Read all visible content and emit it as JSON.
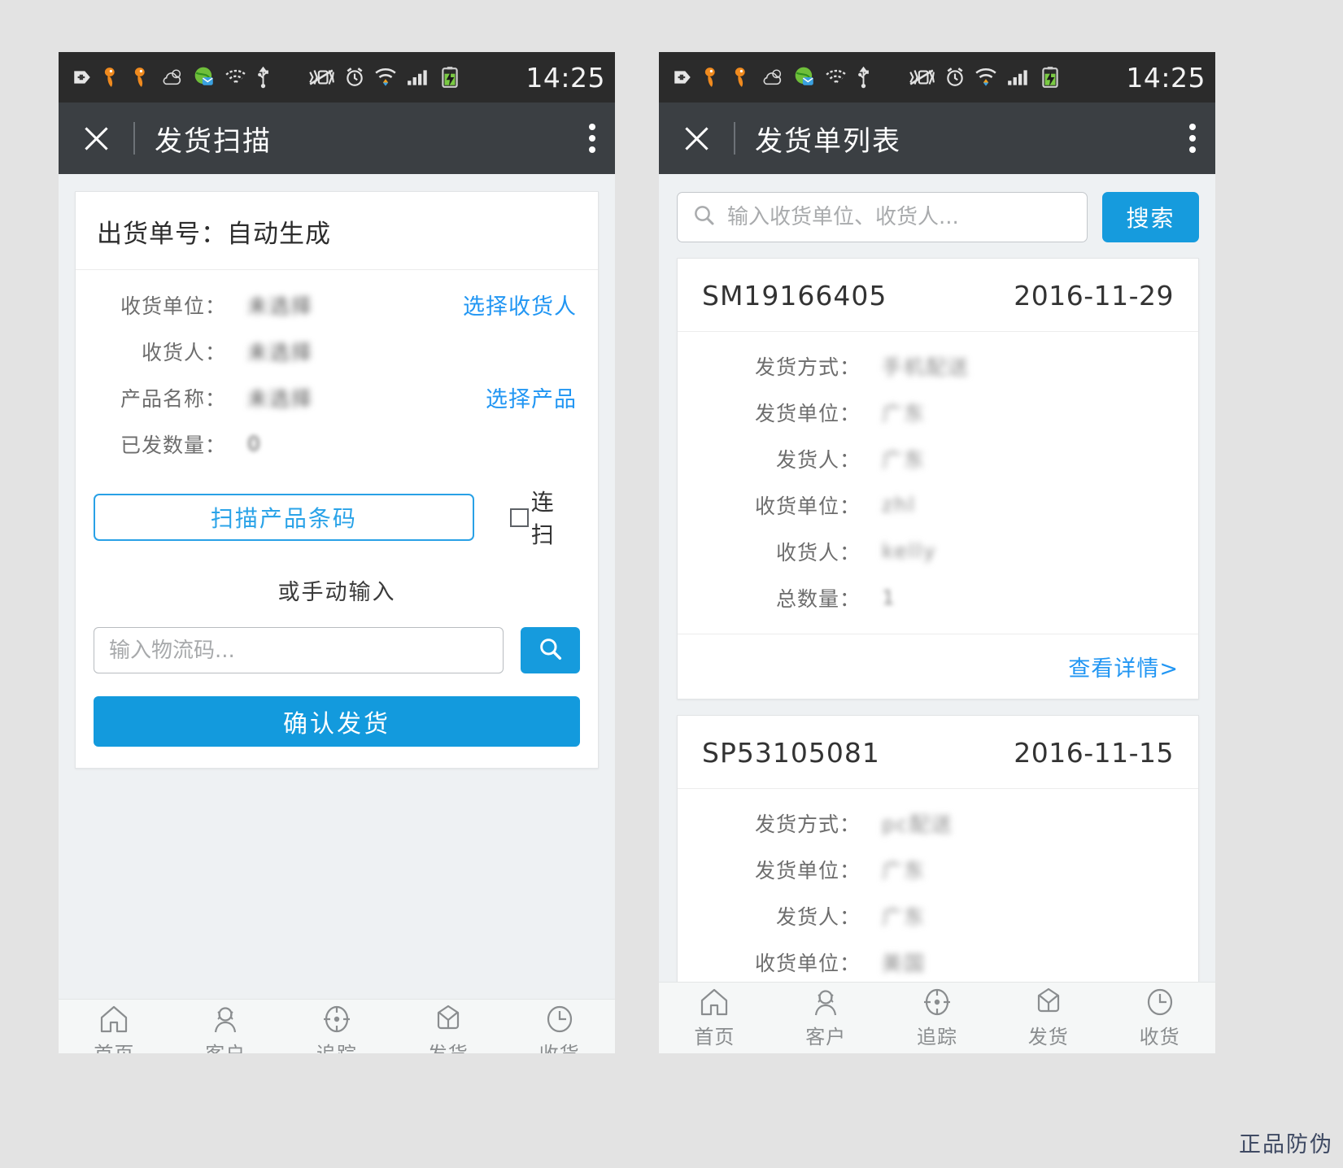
{
  "statusbar": {
    "time": "14:25",
    "icons": [
      "sdcard-plus-icon",
      "uc-browser-icon",
      "uc-browser-icon",
      "weather-cloud-icon",
      "globe-mail-icon",
      "wifi-question-icon",
      "usb-icon",
      "vibrate-off-icon",
      "alarm-clock-icon",
      "wifi-signal-icon",
      "cell-signal-icon",
      "battery-charging-icon"
    ]
  },
  "left": {
    "titlebar": {
      "close_icon": "close-icon",
      "title": "发货扫描",
      "more_icon": "overflow-menu-icon"
    },
    "form": {
      "header": "出货单号：自动生成",
      "rows": [
        {
          "label": "收货单位：",
          "value": "未选择",
          "redacted": true,
          "action": "选择收货人"
        },
        {
          "label": "收货人：",
          "value": "未选择",
          "redacted": true,
          "action": ""
        },
        {
          "label": "产品名称：",
          "value": "未选择",
          "redacted": true,
          "action": "选择产品"
        },
        {
          "label": "已发数量：",
          "value": "0",
          "redacted": true,
          "action": ""
        }
      ],
      "scan_button": "扫描产品条码",
      "continuous_scan_label": "连扫",
      "continuous_scan_checked": false,
      "or_manual": "或手动输入",
      "logistics_input_placeholder": "输入物流码...",
      "logistics_input_value": "",
      "search_icon": "search-icon",
      "confirm_button": "确认发货"
    }
  },
  "right": {
    "titlebar": {
      "close_icon": "close-icon",
      "title": "发货单列表",
      "more_icon": "overflow-menu-icon"
    },
    "search": {
      "icon": "search-icon",
      "placeholder": "输入收货单位、收货人...",
      "value": "",
      "button": "搜索"
    },
    "orders": [
      {
        "no": "SM19166405",
        "date": "2016-11-29",
        "rows": [
          {
            "label": "发货方式：",
            "value": "手机配送",
            "redacted": true
          },
          {
            "label": "发货单位：",
            "value": "广东",
            "redacted": true
          },
          {
            "label": "发货人：",
            "value": "广东",
            "redacted": true
          },
          {
            "label": "收货单位：",
            "value": "zhl",
            "redacted": true
          },
          {
            "label": "收货人：",
            "value": "kelly",
            "redacted": true
          },
          {
            "label": "总数量：",
            "value": "1",
            "redacted": true
          }
        ],
        "detail_link": "查看详情>"
      },
      {
        "no": "SP53105081",
        "date": "2016-11-15",
        "rows": [
          {
            "label": "发货方式：",
            "value": "pc配送",
            "redacted": true
          },
          {
            "label": "发货单位：",
            "value": "广东",
            "redacted": true
          },
          {
            "label": "发货人：",
            "value": "广东",
            "redacted": true
          },
          {
            "label": "收货单位：",
            "value": "美国",
            "redacted": true
          }
        ],
        "detail_link": ""
      }
    ]
  },
  "tabbar": {
    "items": [
      {
        "icon": "home-icon",
        "label": "首页"
      },
      {
        "icon": "users-icon",
        "label": "客户"
      },
      {
        "icon": "target-icon",
        "label": "追踪"
      },
      {
        "icon": "box-icon",
        "label": "发货"
      },
      {
        "icon": "clock-icon",
        "label": "收货"
      }
    ]
  },
  "watermark": "正品防伪",
  "colors": {
    "accent": "#169bdd",
    "link": "#2196f3",
    "statusbar_bg": "#2b2b2b",
    "titlebar_bg": "#3b3f43",
    "page_bg": "#eef1f3",
    "outer_bg": "#e3e3e3"
  }
}
